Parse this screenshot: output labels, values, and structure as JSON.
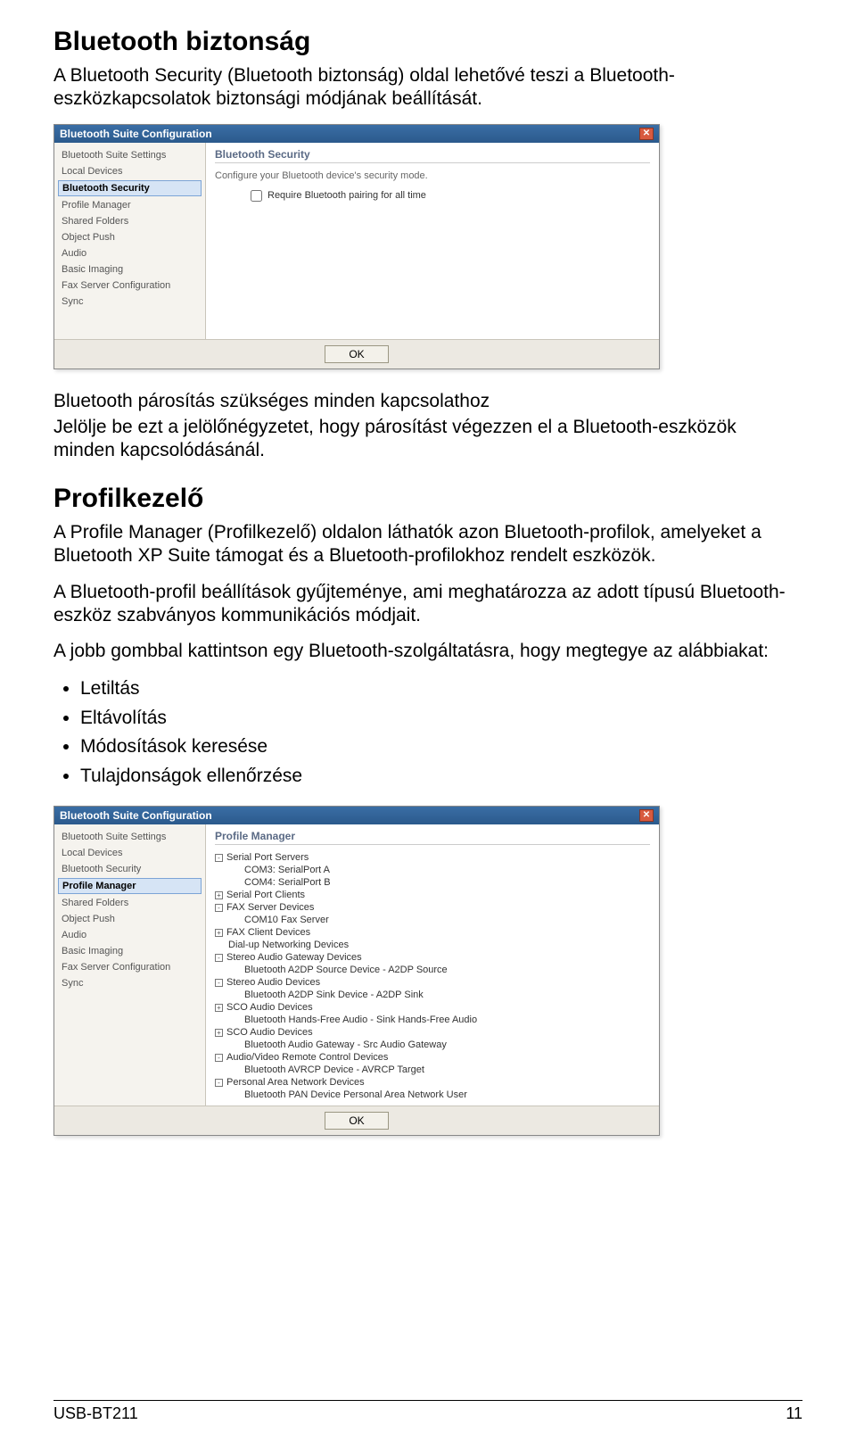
{
  "section1": {
    "title": "Bluetooth biztonság",
    "intro": "A Bluetooth Security (Bluetooth biztonság) oldal lehetővé teszi a Bluetooth-eszközkapcsolatok biztonsági módjának beállítását."
  },
  "dialog1": {
    "title": "Bluetooth Suite Configuration",
    "panel_title": "Bluetooth Security",
    "panel_desc": "Configure your Bluetooth device's security mode.",
    "checkbox_label": "Require Bluetooth pairing for all time",
    "ok_label": "OK",
    "sidebar": [
      "Bluetooth Suite Settings",
      "Local Devices",
      "Bluetooth Security",
      "Profile Manager",
      "Shared Folders",
      "Object Push",
      "Audio",
      "Basic Imaging",
      "Fax Server Configuration",
      "Sync"
    ],
    "selected_index": 2
  },
  "sub1": {
    "heading": "Bluetooth párosítás szükséges minden kapcsolathoz",
    "text": "Jelölje be ezt a jelölőnégyzetet, hogy párosítást végezzen el a Bluetooth-eszközök minden kapcsolódásánál."
  },
  "section2": {
    "title": "Profilkezelő",
    "p1": "A Profile Manager (Profilkezelő) oldalon láthatók azon Bluetooth-profilok, amelyeket a Bluetooth XP Suite támogat és a Bluetooth-profilokhoz rendelt eszközök.",
    "p2": "A Bluetooth-profil beállítások gyűjteménye, ami meghatározza az adott típusú Bluetooth-eszköz szabványos kommunikációs módjait.",
    "p3": "A jobb gombbal kattintson egy Bluetooth-szolgáltatásra, hogy megtegye az alábbiakat:",
    "bullets": [
      "Letiltás",
      "Eltávolítás",
      "Módosítások keresése",
      "Tulajdonságok ellenőrzése"
    ]
  },
  "dialog2": {
    "title": "Bluetooth Suite Configuration",
    "panel_title": "Profile Manager",
    "ok_label": "OK",
    "sidebar": [
      "Bluetooth Suite Settings",
      "Local Devices",
      "Bluetooth Security",
      "Profile Manager",
      "Shared Folders",
      "Object Push",
      "Audio",
      "Basic Imaging",
      "Fax Server Configuration",
      "Sync"
    ],
    "selected_index": 3,
    "tree": [
      {
        "level": 0,
        "exp": "-",
        "label": "Serial Port Servers"
      },
      {
        "level": 1,
        "exp": "",
        "label": "COM3: SerialPort A"
      },
      {
        "level": 1,
        "exp": "",
        "label": "COM4: SerialPort B"
      },
      {
        "level": 0,
        "exp": "+",
        "label": "Serial Port Clients"
      },
      {
        "level": 0,
        "exp": "-",
        "label": "FAX Server Devices"
      },
      {
        "level": 1,
        "exp": "",
        "label": "COM10 Fax Server"
      },
      {
        "level": 0,
        "exp": "+",
        "label": "FAX Client Devices"
      },
      {
        "level": 0,
        "exp": "",
        "label": "Dial-up Networking Devices"
      },
      {
        "level": 0,
        "exp": "-",
        "label": "Stereo Audio Gateway Devices"
      },
      {
        "level": 1,
        "exp": "",
        "label": "Bluetooth A2DP Source Device - A2DP Source"
      },
      {
        "level": 0,
        "exp": "-",
        "label": "Stereo Audio Devices"
      },
      {
        "level": 1,
        "exp": "",
        "label": "Bluetooth A2DP Sink Device - A2DP Sink"
      },
      {
        "level": 0,
        "exp": "+",
        "label": "SCO Audio Devices"
      },
      {
        "level": 1,
        "exp": "",
        "label": "Bluetooth Hands-Free Audio - Sink Hands-Free Audio"
      },
      {
        "level": 0,
        "exp": "+",
        "label": "SCO Audio Devices"
      },
      {
        "level": 1,
        "exp": "",
        "label": "Bluetooth Audio Gateway - Src Audio Gateway"
      },
      {
        "level": 0,
        "exp": "-",
        "label": "Audio/Video Remote Control Devices"
      },
      {
        "level": 1,
        "exp": "",
        "label": "Bluetooth AVRCP Device - AVRCP Target"
      },
      {
        "level": 0,
        "exp": "-",
        "label": "Personal Area Network Devices"
      },
      {
        "level": 1,
        "exp": "",
        "label": "Bluetooth PAN Device Personal Area Network User"
      }
    ]
  },
  "footer": {
    "left": "USB-BT211",
    "right": "11"
  }
}
